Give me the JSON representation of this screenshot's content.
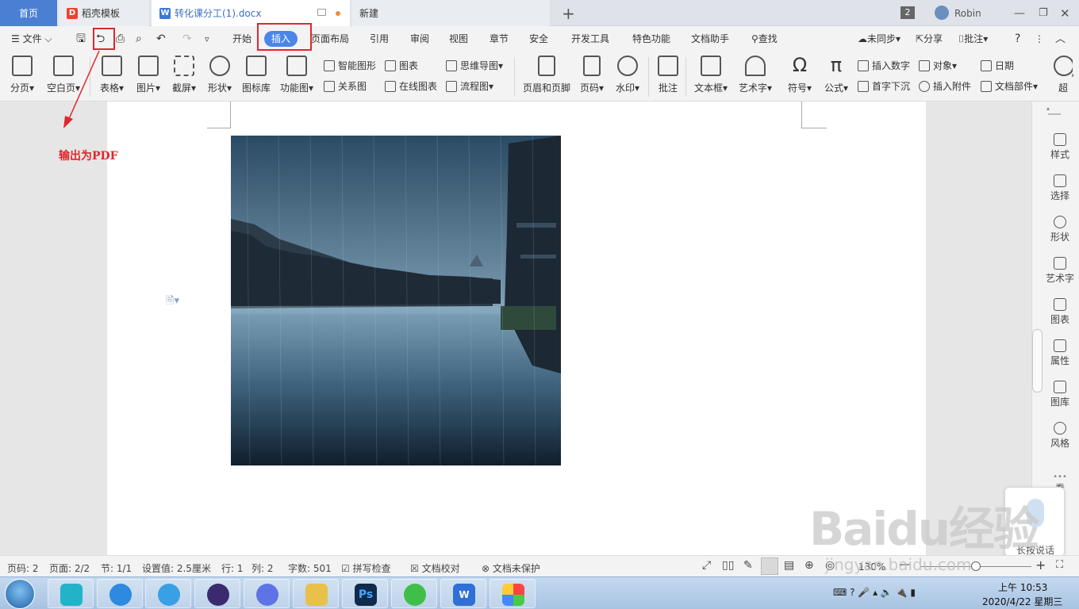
{
  "titlebar": {
    "tabs": [
      {
        "label": "首页"
      },
      {
        "label": "稻壳模板"
      },
      {
        "label": "转化课分工(1).docx"
      },
      {
        "label": "新建"
      }
    ],
    "add_tab": "+",
    "window_count": "2",
    "user": "Robin"
  },
  "menu": {
    "file": "文件",
    "items": [
      "开始",
      "插入",
      "页面布局",
      "引用",
      "审阅",
      "视图",
      "章节",
      "安全",
      "开发工具",
      "特色功能",
      "文档助手"
    ],
    "search": "查找",
    "sync": "未同步",
    "share": "分享",
    "comment": "批注",
    "help": "?"
  },
  "ribbon": {
    "big": [
      "分页",
      "空白页",
      "表格",
      "图片",
      "截屏",
      "形状",
      "图标库",
      "功能图",
      "页眉和页脚",
      "页码",
      "水印",
      "批注",
      "文本框",
      "艺术字",
      "符号",
      "公式",
      "超"
    ],
    "small": [
      "智能图形",
      "关系图",
      "图表",
      "在线图表",
      "思维导图",
      "流程图",
      "插入数字",
      "首字下沉",
      "对象",
      "插入附件",
      "日期",
      "文档部件"
    ]
  },
  "annotation": "输出为PDF",
  "sidebar": [
    "样式",
    "选择",
    "形状",
    "艺术字",
    "图表",
    "属性",
    "图库",
    "风格",
    "看"
  ],
  "voice": "长按说话",
  "status": {
    "page_num": "页码: 2",
    "pages": "页面: 2/2",
    "section": "节: 1/1",
    "setting": "设置值: 2.5厘米",
    "row": "行: 1",
    "col": "列: 2",
    "words": "字数: 501",
    "spell": "拼写检查",
    "proof": "文档校对",
    "protect": "文档未保护",
    "zoom": "130%"
  },
  "clock": {
    "time": "上午 10:53",
    "date": "2020/4/22 星期三"
  },
  "watermark": {
    "main": "Baidu经验",
    "url": "jingyan.baidu.com"
  },
  "colors": {
    "accent": "#4a86e8",
    "annotation": "#e1262c",
    "home_tab": "#4a7fd4"
  }
}
